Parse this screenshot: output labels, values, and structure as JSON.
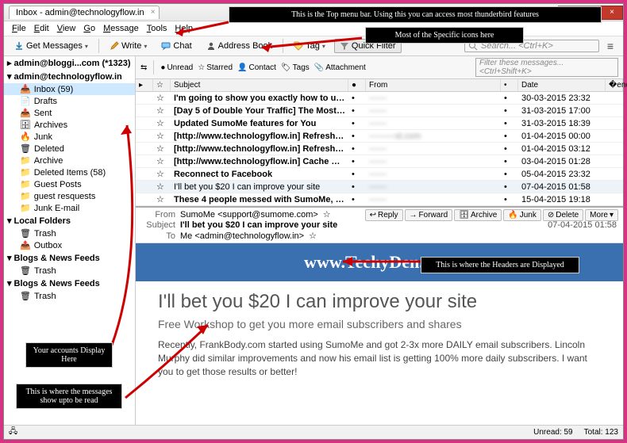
{
  "window": {
    "title": "Inbox - admin@technologyflow.in",
    "min": "—",
    "max": "□",
    "close": "×"
  },
  "menus": [
    "File",
    "Edit",
    "View",
    "Go",
    "Message",
    "Tools",
    "Help"
  ],
  "toolbar": {
    "get": "Get Messages",
    "write": "Write",
    "chat": "Chat",
    "ab": "Address Book",
    "tag": "Tag",
    "qf": "Quick Filter",
    "search_ph": "Search...  <Ctrl+K>"
  },
  "sidebar": {
    "acct1": "admin@bloggi...com (*1323)",
    "acct2": "admin@technologyflow.in",
    "folders": [
      {
        "n": "Inbox (59)",
        "sel": true,
        "i": "inbox"
      },
      {
        "n": "Drafts",
        "i": "draft"
      },
      {
        "n": "Sent",
        "i": "sent"
      },
      {
        "n": "Archives",
        "i": "archive"
      },
      {
        "n": "Junk",
        "i": "junk"
      },
      {
        "n": "Deleted",
        "i": "trash"
      },
      {
        "n": "Archive",
        "i": "folder"
      },
      {
        "n": "Deleted Items (58)",
        "i": "folder"
      },
      {
        "n": "Guest Posts",
        "i": "folder"
      },
      {
        "n": "guest resquests",
        "i": "folder"
      },
      {
        "n": "Junk E-mail",
        "i": "folder"
      }
    ],
    "local": "Local Folders",
    "local_folders": [
      {
        "n": "Trash",
        "i": "trash"
      },
      {
        "n": "Outbox",
        "i": "out"
      }
    ],
    "feeds_a": "Blogs & News Feeds",
    "feeds_a_f": [
      {
        "n": "Trash",
        "i": "trash"
      }
    ],
    "feeds_b": "Blogs & News Feeds",
    "feeds_b_f": [
      {
        "n": "Trash",
        "i": "trash"
      }
    ]
  },
  "filter": {
    "unread": "Unread",
    "starred": "Starred",
    "contact": "Contact",
    "tags": "Tags",
    "attach": "Attachment",
    "ph": "Filter these messages...  <Ctrl+Shift+K>"
  },
  "columns": {
    "sub": "Subject",
    "from": "From",
    "date": "Date"
  },
  "rows": [
    {
      "s": "I'm going to show you exactly how to use S——",
      "f": "——",
      "d": "30-03-2015 23:32"
    },
    {
      "s": "[Day 5 of Double Your Traffic] The Most Su——",
      "f": "——",
      "d": "31-03-2015 17:00"
    },
    {
      "s": "Updated SumoMe features for You",
      "f": "——",
      "d": "31-03-2015 18:39"
    },
    {
      "s": "[http://www.technologyflow.in] Refreshing——",
      "f": "———st.com",
      "d": "01-04-2015 00:00"
    },
    {
      "s": "[http://www.technologyflow.in] Refreshing——",
      "f": "——",
      "d": "01-04-2015 03:12"
    },
    {
      "s": "[http://www.technologyflow.in] Cache Pre——",
      "f": "——",
      "d": "03-04-2015 01:28"
    },
    {
      "s": "Reconnect to Facebook",
      "f": "——",
      "d": "05-04-2015 23:32"
    },
    {
      "s": "I'll bet you $20 I can improve your site",
      "f": "——",
      "d": "07-04-2015 01:58",
      "sel": true
    },
    {
      "s": "These 4 people messed with SumoMe, see ——",
      "f": "——",
      "d": "15-04-2015 19:18"
    }
  ],
  "header": {
    "from_l": "From",
    "from": "SumoMe <support@sumome.com>",
    "subj_l": "Subject",
    "subj": "I'll bet you $20 I can improve your site",
    "to_l": "To",
    "to": "Me <admin@technologyflow.in>",
    "date": "07-04-2015 01:58",
    "reply": "Reply",
    "forward": "Forward",
    "archive": "Archive",
    "junk": "Junk",
    "delete": "Delete",
    "more": "More"
  },
  "message": {
    "banner": "www.TechyDen.com",
    "h1": "I'll bet you $20 I can improve your site",
    "h2": "Free Workshop to get you more email subscribers and shares",
    "p": "Recently, FrankBody.com started using SumoMe and got 2-3x more DAILY email subscribers. Lincoln Murphy did similar improvements and now his email list is getting 100% more daily subscribers. I want you to get those results or better!"
  },
  "status": {
    "unread": "Unread: 59",
    "total": "Total: 123"
  },
  "annot": {
    "top": "This is the Top menu bar. Using this you can access most thunderbird features",
    "icons": "Most of the Specific icons here",
    "accts": "Your accounts Display Here",
    "msgs": "This is where the messages show upto be read",
    "hdrs": "This is where the Headers are Displayed"
  }
}
